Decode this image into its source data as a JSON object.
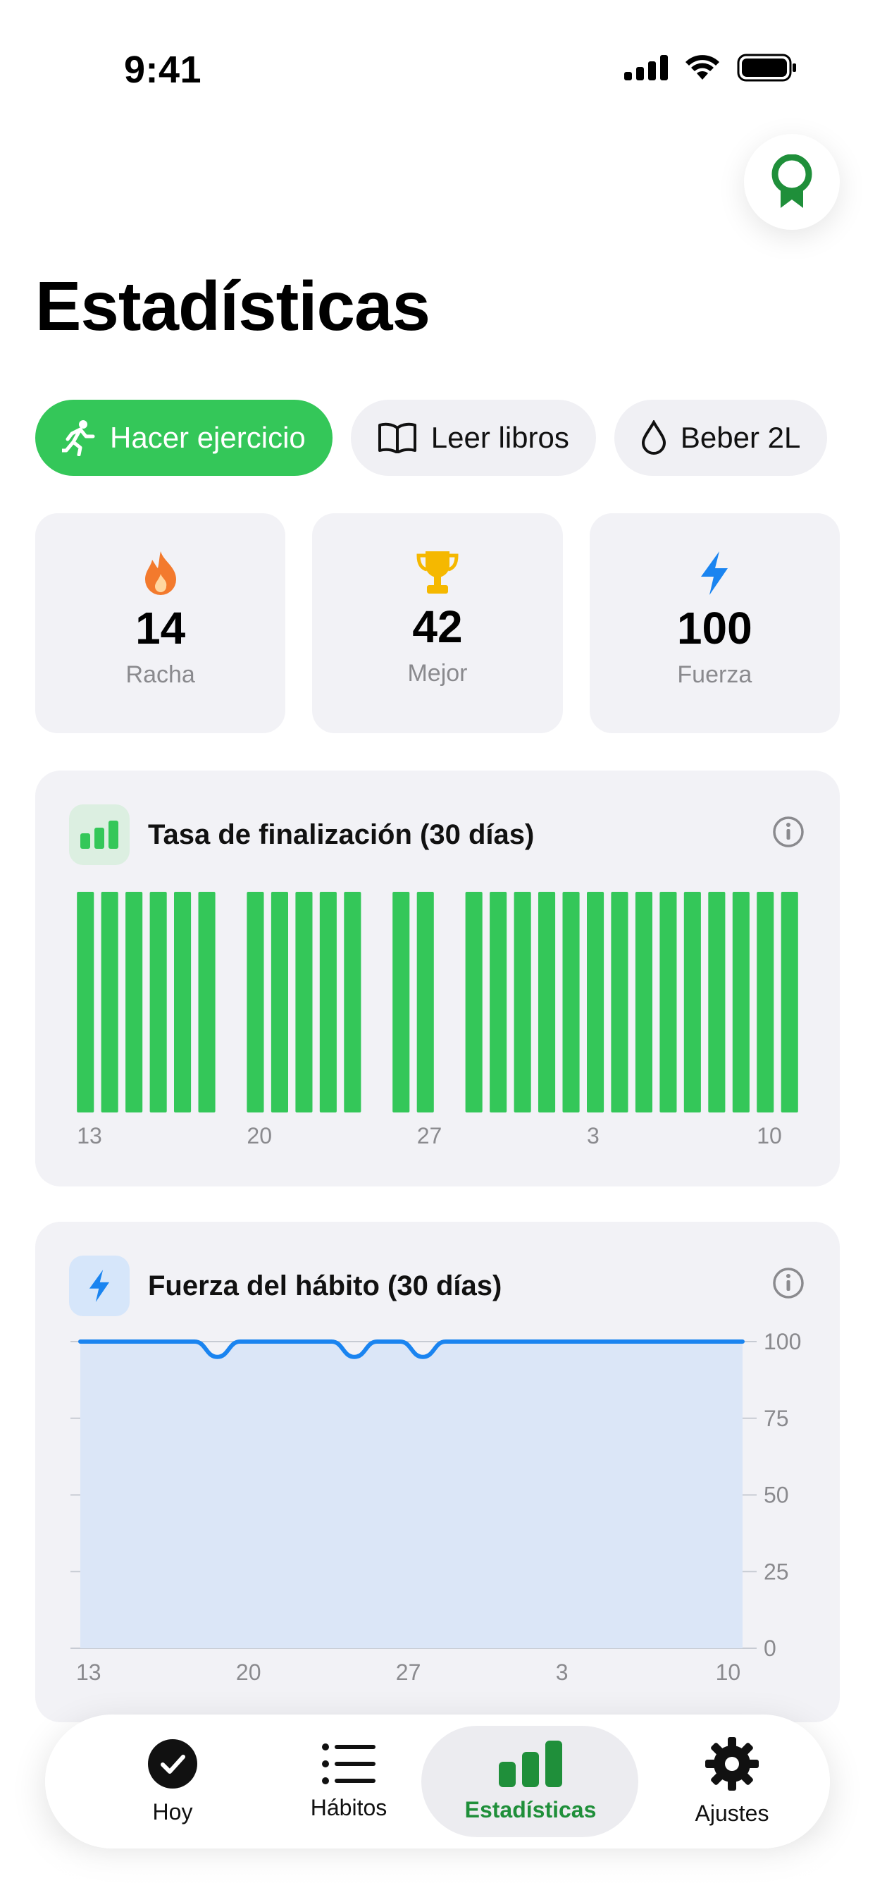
{
  "status_bar": {
    "time": "9:41"
  },
  "page": {
    "title": "Estadísticas"
  },
  "habit_chips": [
    {
      "label": "Hacer ejercicio",
      "icon": "running-figure-icon",
      "active": true
    },
    {
      "label": "Leer libros",
      "icon": "open-book-icon",
      "active": false
    },
    {
      "label": "Beber 2L",
      "icon": "water-drop-icon",
      "active": false
    }
  ],
  "stats": [
    {
      "value": "14",
      "label": "Racha",
      "icon": "flame-icon"
    },
    {
      "value": "42",
      "label": "Mejor",
      "icon": "trophy-icon"
    },
    {
      "value": "100",
      "label": "Fuerza",
      "icon": "bolt-icon"
    }
  ],
  "completion_card": {
    "title": "Tasa de finalización (30 días)",
    "icon": "bar-chart-icon"
  },
  "strength_card": {
    "title": "Fuerza del hábito (30 días)",
    "icon": "bolt-icon"
  },
  "chart_data": [
    {
      "type": "bar",
      "title": "Tasa de finalización (30 días)",
      "x_tick_labels": [
        "13",
        "20",
        "27",
        "3",
        "10"
      ],
      "days": [
        "13",
        "14",
        "15",
        "16",
        "17",
        "18",
        "19",
        "20",
        "21",
        "22",
        "23",
        "24",
        "25",
        "26",
        "27",
        "28",
        "29",
        "30",
        "31",
        "1",
        "2",
        "3",
        "4",
        "5",
        "6",
        "7",
        "8",
        "9",
        "10",
        "11"
      ],
      "values": [
        1,
        1,
        1,
        1,
        1,
        1,
        0,
        1,
        1,
        1,
        1,
        1,
        0,
        1,
        1,
        0,
        1,
        1,
        1,
        1,
        1,
        1,
        1,
        1,
        1,
        1,
        1,
        1,
        1,
        1
      ],
      "ylim": [
        0,
        1
      ],
      "color": "#34c759"
    },
    {
      "type": "area",
      "title": "Fuerza del hábito (30 días)",
      "x_tick_labels": [
        "13",
        "20",
        "27",
        "3",
        "10"
      ],
      "y_tick_labels": [
        "100",
        "75",
        "50",
        "25",
        "0"
      ],
      "x": [
        "13",
        "14",
        "15",
        "16",
        "17",
        "18",
        "19",
        "20",
        "21",
        "22",
        "23",
        "24",
        "25",
        "26",
        "27",
        "28",
        "29",
        "30",
        "31",
        "1",
        "2",
        "3",
        "4",
        "5",
        "6",
        "7",
        "8",
        "9",
        "10",
        "11"
      ],
      "values": [
        100,
        100,
        100,
        100,
        100,
        100,
        95,
        100,
        100,
        100,
        100,
        100,
        95,
        100,
        100,
        95,
        100,
        100,
        100,
        100,
        100,
        100,
        100,
        100,
        100,
        100,
        100,
        100,
        100,
        100
      ],
      "ylim": [
        0,
        100
      ],
      "grid": true,
      "line_color": "#1a84f0",
      "fill_color": "#dbe6f7"
    }
  ],
  "tab_bar": [
    {
      "label": "Hoy",
      "icon": "checkmark-circle-icon",
      "active": false
    },
    {
      "label": "Hábitos",
      "icon": "list-icon",
      "active": false
    },
    {
      "label": "Estadísticas",
      "icon": "bar-chart-icon",
      "active": true
    },
    {
      "label": "Ajustes",
      "icon": "gear-icon",
      "active": false
    }
  ]
}
